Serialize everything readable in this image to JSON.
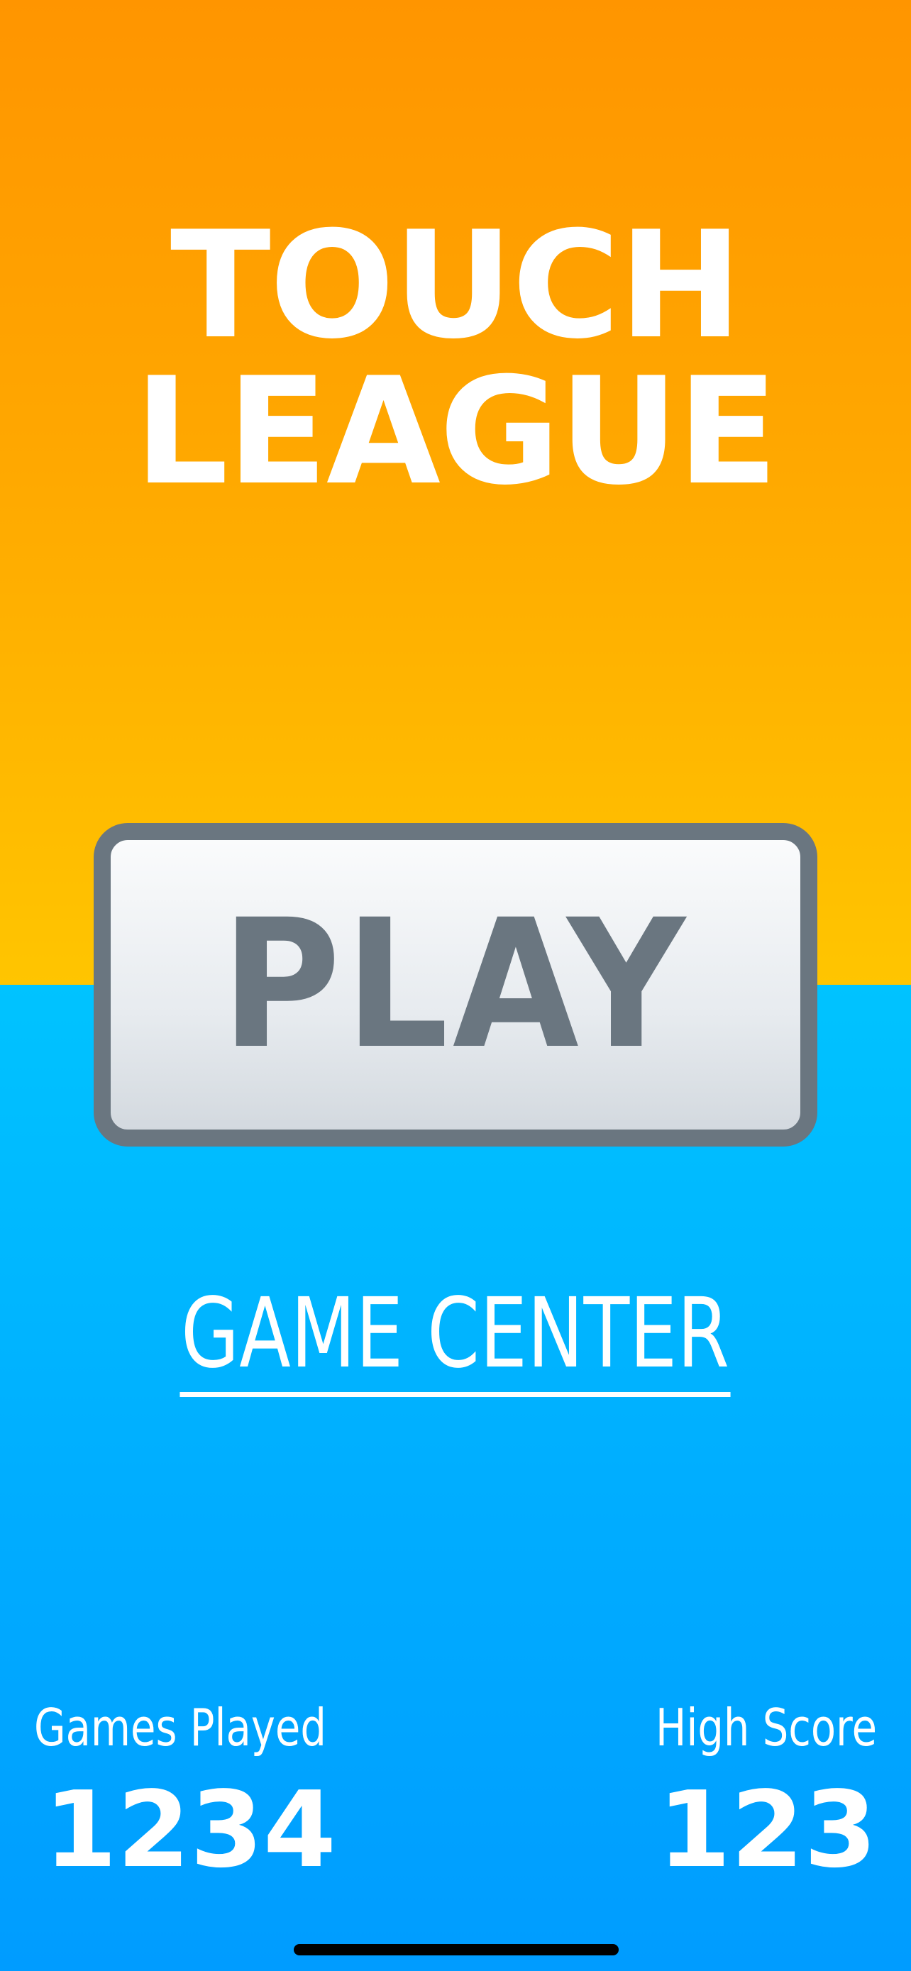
{
  "app": {
    "title_lines": [
      "TOUCH",
      "LEAGUE"
    ]
  },
  "menu": {
    "play_label": "PLAY",
    "game_center_label": "GAME CENTER"
  },
  "stats": {
    "games_played": {
      "label": "Games Played",
      "value": "1234"
    },
    "high_score": {
      "label": "High Score",
      "value": "123"
    }
  },
  "colors": {
    "top_background": "#FFA700",
    "bottom_background": "#00AEFF",
    "button_border": "#6A7680",
    "button_fill": "#E7EBEF",
    "text": "#FFFFFF"
  }
}
